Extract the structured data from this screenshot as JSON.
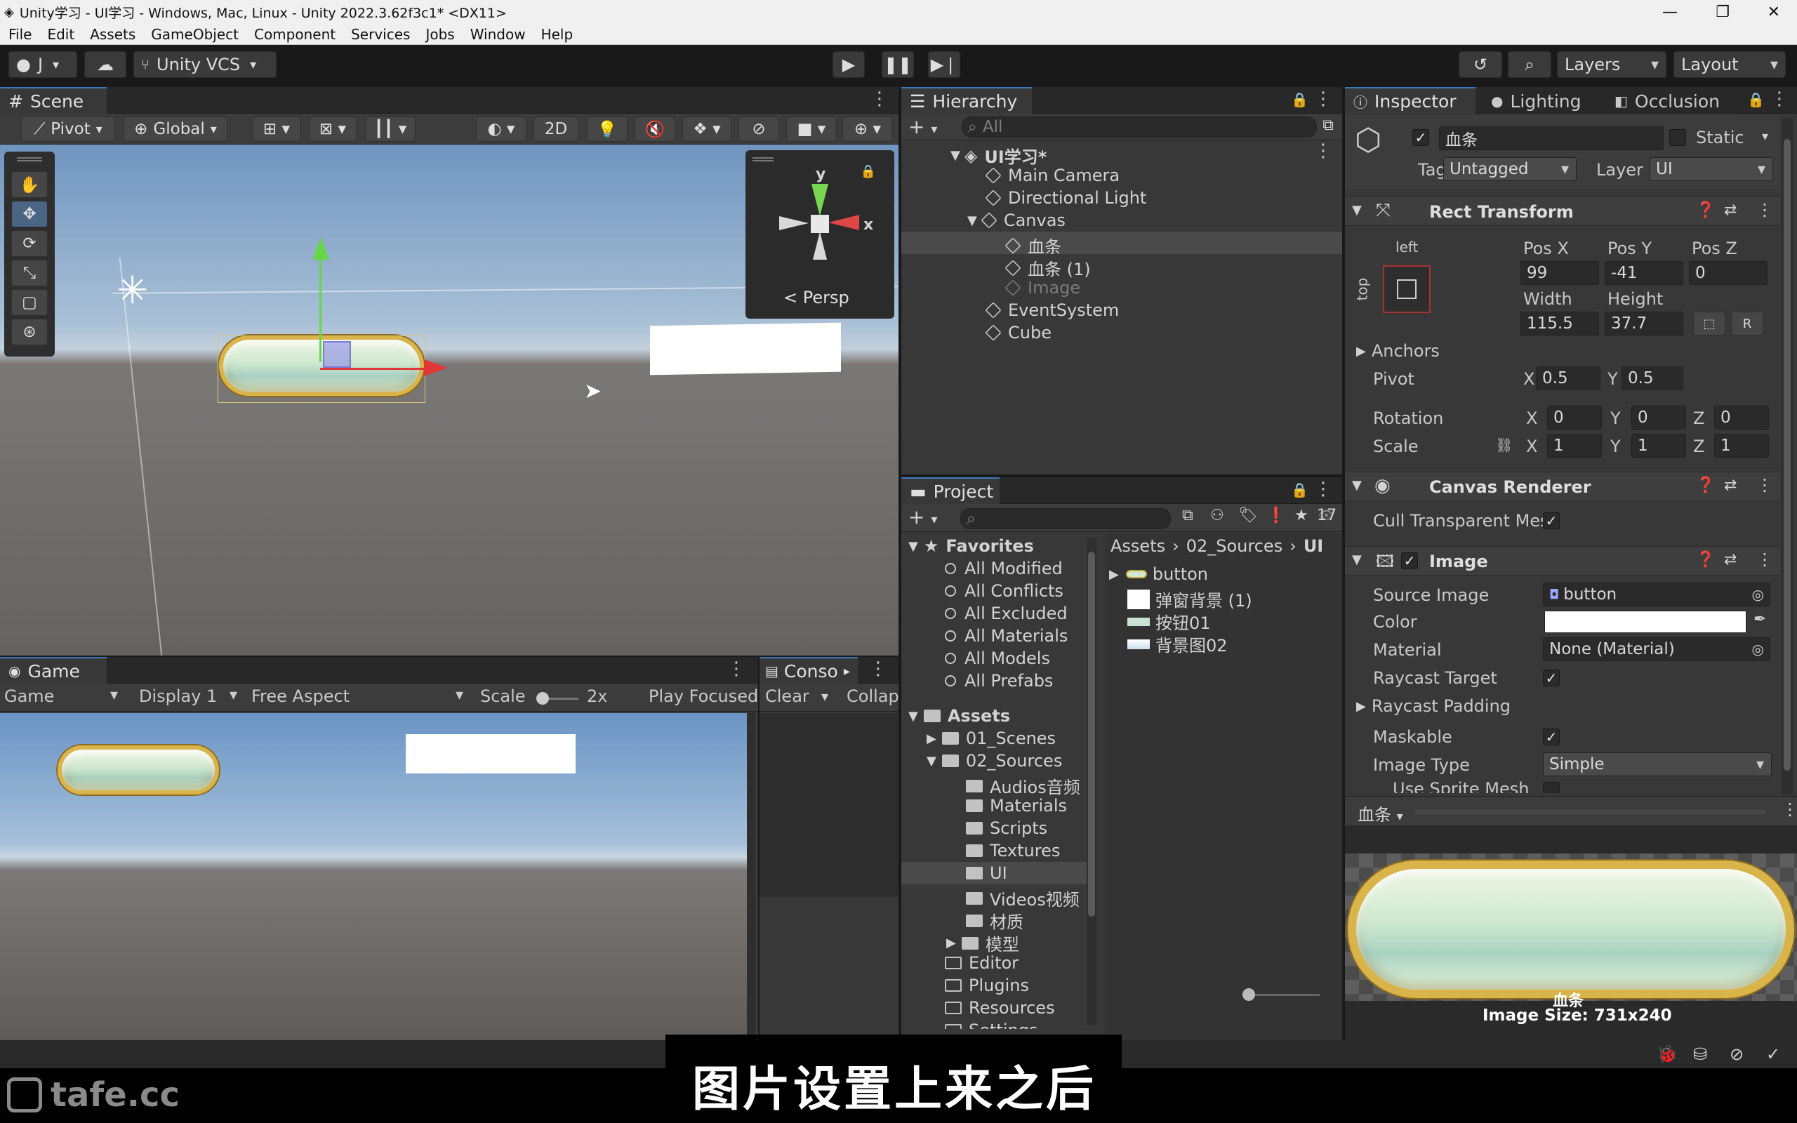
{
  "window": {
    "title": "Unity学习 - UI学习 - Windows, Mac, Linux - Unity 2022.3.62f3c1* <DX11>"
  },
  "menu": [
    "File",
    "Edit",
    "Assets",
    "GameObject",
    "Component",
    "Services",
    "Jobs",
    "Window",
    "Help"
  ],
  "toolbar": {
    "account": "J",
    "vcs": "Unity VCS",
    "layers": "Layers",
    "layout": "Layout"
  },
  "scene": {
    "tab": "Scene",
    "pivot": "Pivot",
    "global": "Global",
    "mode2d": "2D",
    "persp": "< Persp",
    "gizmo_y": "y",
    "gizmo_x": "x"
  },
  "game": {
    "tab": "Game",
    "mode": "Game",
    "display": "Display 1",
    "aspect": "Free Aspect",
    "scale_label": "Scale",
    "scale_value": "2x",
    "play_focused": "Play Focused"
  },
  "console": {
    "tab": "Conso",
    "clear": "Clear",
    "collapse": "Collap"
  },
  "hierarchy": {
    "tab": "Hierarchy",
    "search_placeholder": "All",
    "scene_name": "UI学习*",
    "items": [
      "Main Camera",
      "Directional Light",
      "Canvas",
      "血条",
      "血条 (1)",
      "Image",
      "EventSystem",
      "Cube"
    ]
  },
  "project": {
    "tab": "Project",
    "count": "17",
    "favorites_label": "Favorites",
    "favorites": [
      "All Modified",
      "All Conflicts",
      "All Excluded",
      "All Materials",
      "All Models",
      "All Prefabs"
    ],
    "assets_label": "Assets",
    "tree": [
      "01_Scenes",
      "02_Sources",
      "Audios音频",
      "Materials",
      "Scripts",
      "Textures",
      "UI",
      "Videos视频",
      "材质",
      "模型",
      "Editor",
      "Plugins",
      "Resources",
      "Settings"
    ],
    "breadcrumb": [
      "Assets",
      "02_Sources",
      "UI"
    ],
    "files": [
      "button",
      "弹窗背景 (1)",
      "按钮01",
      "背景图02"
    ]
  },
  "inspector": {
    "tabs": [
      "Inspector",
      "Lighting",
      "Occlusion"
    ],
    "object_name": "血条",
    "static_label": "Static",
    "tag_label": "Tag",
    "tag_value": "Untagged",
    "layer_label": "Layer",
    "layer_value": "UI",
    "rect": {
      "title": "Rect Transform",
      "anchor_h": "left",
      "anchor_v": "top",
      "posx_label": "Pos X",
      "posy_label": "Pos Y",
      "posz_label": "Pos Z",
      "posx": "99",
      "posy": "-41",
      "posz": "0",
      "width_label": "Width",
      "height_label": "Height",
      "width": "115.5",
      "height": "37.7",
      "anchors": "Anchors",
      "pivot": "Pivot",
      "pivot_x": "0.5",
      "pivot_y": "0.5",
      "rotation": "Rotation",
      "rot_x": "0",
      "rot_y": "0",
      "rot_z": "0",
      "scale": "Scale",
      "scale_x": "1",
      "scale_y": "1",
      "scale_z": "1",
      "x": "X",
      "y": "Y",
      "z": "Z",
      "r": "R"
    },
    "canvas_renderer": {
      "title": "Canvas Renderer",
      "cull": "Cull Transparent Mes"
    },
    "image": {
      "title": "Image",
      "source_label": "Source Image",
      "source_value": "button",
      "color_label": "Color",
      "material_label": "Material",
      "material_value": "None (Material)",
      "raycast_target": "Raycast Target",
      "raycast_padding": "Raycast Padding",
      "maskable": "Maskable",
      "image_type_label": "Image Type",
      "image_type_value": "Simple",
      "use_sprite_mesh": "Use Sprite Mesh"
    },
    "preview": {
      "name": "血条",
      "caption": "血条",
      "size": "Image Size: 731x240"
    }
  },
  "watermark": "tafe.cc",
  "subtitle": "图片设置上来之后"
}
